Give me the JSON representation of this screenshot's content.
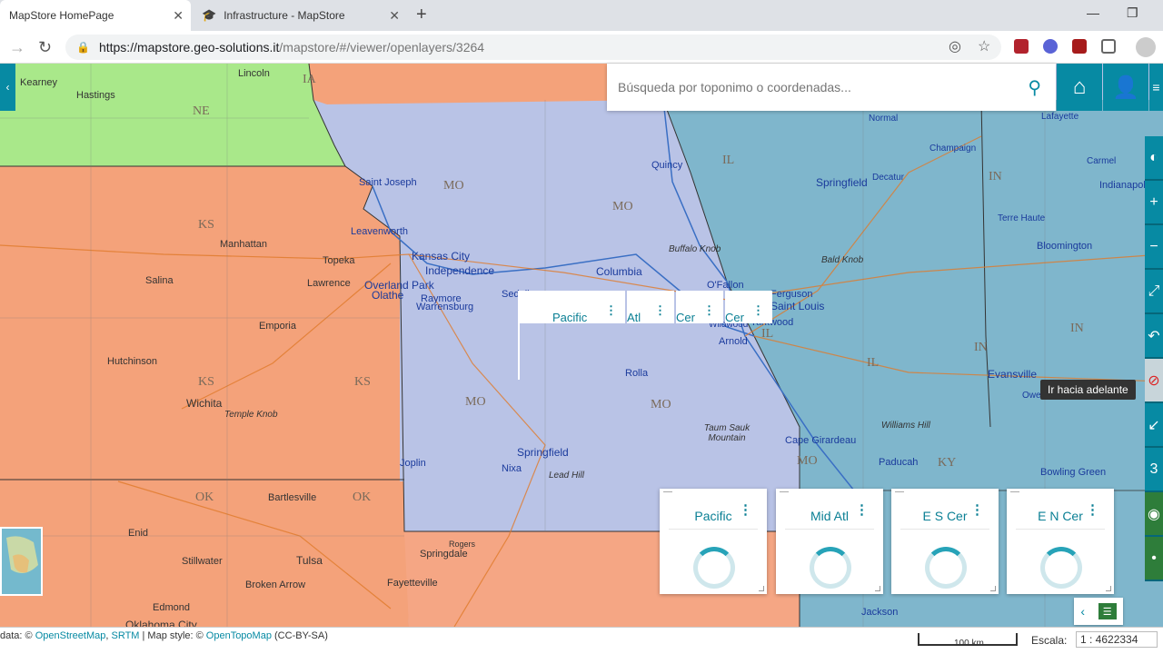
{
  "browser": {
    "tabs": [
      {
        "title": "MapStore HomePage",
        "close": "✕"
      },
      {
        "title": "Infrastructure - MapStore",
        "close": "✕"
      }
    ],
    "new_tab": "+",
    "url_host": "https://mapstore.geo-solutions.it",
    "url_path": "/mapstore/#/viewer/openlayers/3264"
  },
  "search": {
    "placeholder": "Búsqueda por toponimo o coordenadas..."
  },
  "tooltip": "Ir hacia adelante",
  "map_labels": {
    "states": [
      "IA",
      "NE",
      "KS",
      "KS",
      "KS",
      "OK",
      "OK",
      "MO",
      "MO",
      "MO",
      "MO",
      "IL",
      "IL",
      "IL",
      "IN",
      "IN",
      "IN",
      "MO",
      "KY"
    ],
    "cities": [
      "Kearney",
      "Hastings",
      "Lincoln",
      "Saint Joseph",
      "Manhattan",
      "Leavenworth",
      "Kansas City",
      "Topeka",
      "Independence",
      "Salina",
      "Lawrence",
      "Overland Park",
      "Olathe",
      "Raymore",
      "Warrensburg",
      "Sedalia",
      "Columbia",
      "Quincy",
      "Springfield",
      "Normal",
      "Champaign",
      "Decatur",
      "Terre Haute",
      "Bloomington",
      "Indianapolis",
      "Carmel",
      "Lafayette",
      "O'Fallon",
      "Saint Louis",
      "Ferguson",
      "Kirkwood",
      "Wildwood",
      "Arnold",
      "Emporia",
      "Hutchinson",
      "Wichita",
      "Rolla",
      "Joplin",
      "Springfield",
      "Nixa",
      "Bartlesville",
      "Enid",
      "Stillwater",
      "Tulsa",
      "Broken Arrow",
      "Edmond",
      "Oklahoma City",
      "Rogers",
      "Springdale",
      "Fayetteville",
      "Cape Girardeau",
      "Paducah",
      "Evansville",
      "Bowling Green",
      "Jackson",
      "Owensboro"
    ],
    "mountains": [
      "Buffalo Knob",
      "Bald Knob",
      "Temple Knob",
      "Taum Sauk Mountain",
      "Williams Hill",
      "Lead Hill"
    ]
  },
  "mini_widgets": [
    "Pacific",
    "Atl",
    "Cer",
    "Cer"
  ],
  "widgets": [
    {
      "title": "Pacific",
      "menu": "⋮"
    },
    {
      "title": "Mid Atl",
      "menu": "⋮"
    },
    {
      "title": "E S Cer",
      "menu": "⋮"
    },
    {
      "title": "E N Cer",
      "menu": "⋮"
    }
  ],
  "footer": {
    "attrib_prefix": "data: ©",
    "osm": "OpenStreetMap",
    "srtm": "SRTM",
    "style_prefix": "| Map style: ©",
    "opentopo": "OpenTopoMap",
    "license": "(CC-BY-SA)",
    "scale_bar": "100 km",
    "scale_label": "Escala:",
    "scale_value": "1 : 4622334"
  },
  "colors": {
    "accent": "#078aa3",
    "kansas": "#f4a27a",
    "nebraska": "#a9e88a",
    "missouri": "#b9c3e6",
    "illinois": "#7fb6cc"
  }
}
